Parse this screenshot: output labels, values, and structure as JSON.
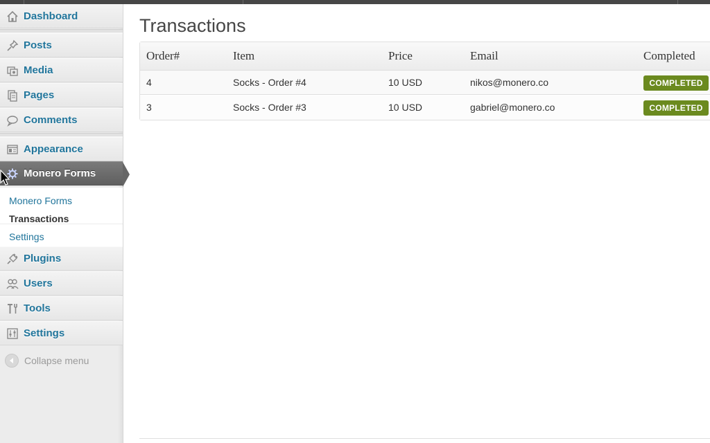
{
  "sidebar": {
    "items": [
      {
        "id": "dashboard",
        "label": "Dashboard",
        "icon": "house-icon"
      },
      {
        "id": "posts",
        "label": "Posts",
        "icon": "pushpin-icon"
      },
      {
        "id": "media",
        "label": "Media",
        "icon": "media-icon"
      },
      {
        "id": "pages",
        "label": "Pages",
        "icon": "pages-icon"
      },
      {
        "id": "comments",
        "label": "Comments",
        "icon": "speech-bubble-icon"
      },
      {
        "id": "appearance",
        "label": "Appearance",
        "icon": "appearance-icon"
      },
      {
        "id": "monero-forms",
        "label": "Monero Forms",
        "icon": "gear-icon"
      },
      {
        "id": "plugins",
        "label": "Plugins",
        "icon": "plug-icon"
      },
      {
        "id": "users",
        "label": "Users",
        "icon": "users-icon"
      },
      {
        "id": "tools",
        "label": "Tools",
        "icon": "tools-icon"
      },
      {
        "id": "settings",
        "label": "Settings",
        "icon": "sliders-icon"
      }
    ],
    "active_item": "Monero Forms",
    "submenu": [
      "Monero Forms",
      "Transactions",
      "Settings"
    ],
    "current_submenu": "Transactions",
    "collapse_label": "Collapse menu"
  },
  "main": {
    "title": "Transactions",
    "table": {
      "columns": [
        "Order#",
        "Item",
        "Price",
        "Email",
        "Completed"
      ],
      "rows": [
        {
          "order": "4",
          "item": "Socks - Order #4",
          "price": "10 USD",
          "email": "nikos@monero.co",
          "status": "COMPLETED"
        },
        {
          "order": "3",
          "item": "Socks - Order #3",
          "price": "10 USD",
          "email": "gabriel@monero.co",
          "status": "COMPLETED"
        }
      ]
    }
  },
  "colors": {
    "link": "#21759b",
    "active_menu": "#666666",
    "badge": "#6b8a1f"
  }
}
